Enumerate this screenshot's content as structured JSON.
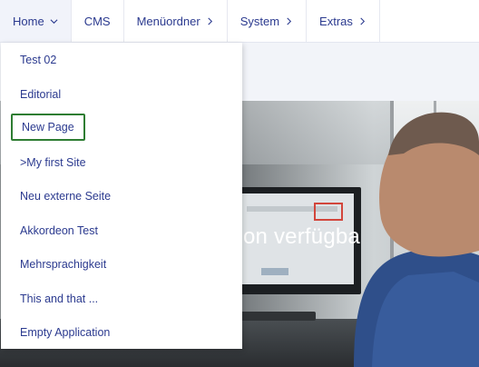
{
  "nav": {
    "items": [
      {
        "label": "Home",
        "chevron": "down"
      },
      {
        "label": "CMS"
      },
      {
        "label": "Menüordner",
        "chevron": "right"
      },
      {
        "label": "System",
        "chevron": "right"
      },
      {
        "label": "Extras",
        "chevron": "right"
      }
    ]
  },
  "dropdown": {
    "items": [
      {
        "label": "Test 02"
      },
      {
        "label": "Editorial"
      },
      {
        "label": "New Page",
        "focused": true
      },
      {
        "label": ">My first Site"
      },
      {
        "label": "Neu externe Seite"
      },
      {
        "label": "Akkordeon Test"
      },
      {
        "label": "Mehrsprachigkeit"
      },
      {
        "label": "This and that ..."
      },
      {
        "label": "Empty Application"
      }
    ]
  },
  "hero": {
    "visible_text": "on verfügba"
  },
  "colors": {
    "link": "#2b3a8f",
    "focus_outline": "#2e7d32",
    "active_nav_bg": "#f1f3fa"
  },
  "icons": {
    "home_chevron": "chevron-down-icon",
    "submenu_chevron": "chevron-right-icon"
  }
}
